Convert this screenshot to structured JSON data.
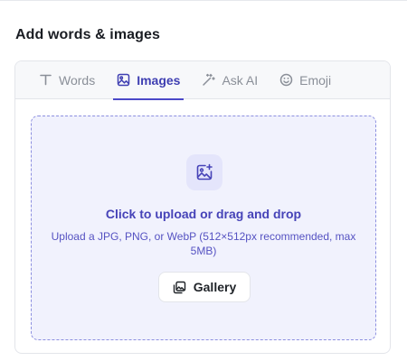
{
  "section": {
    "title": "Add words & images"
  },
  "tabs": [
    {
      "label": "Words",
      "icon": "text-icon",
      "active": false
    },
    {
      "label": "Images",
      "icon": "image-icon",
      "active": true
    },
    {
      "label": "Ask AI",
      "icon": "magic-wand-icon",
      "active": false
    },
    {
      "label": "Emoji",
      "icon": "smiley-icon",
      "active": false
    }
  ],
  "upload": {
    "icon": "image-plus-icon",
    "title": "Click to upload or drag and drop",
    "subtitle": "Upload a JPG, PNG, or WebP (512×512px recommended, max 5MB)",
    "gallery_label": "Gallery",
    "gallery_icon": "gallery-icon"
  },
  "colors": {
    "accent": "#4b48c8",
    "accent_text": "#4643b8",
    "dropzone_bg": "#f1f2fd",
    "muted_text": "#8a8f98"
  }
}
